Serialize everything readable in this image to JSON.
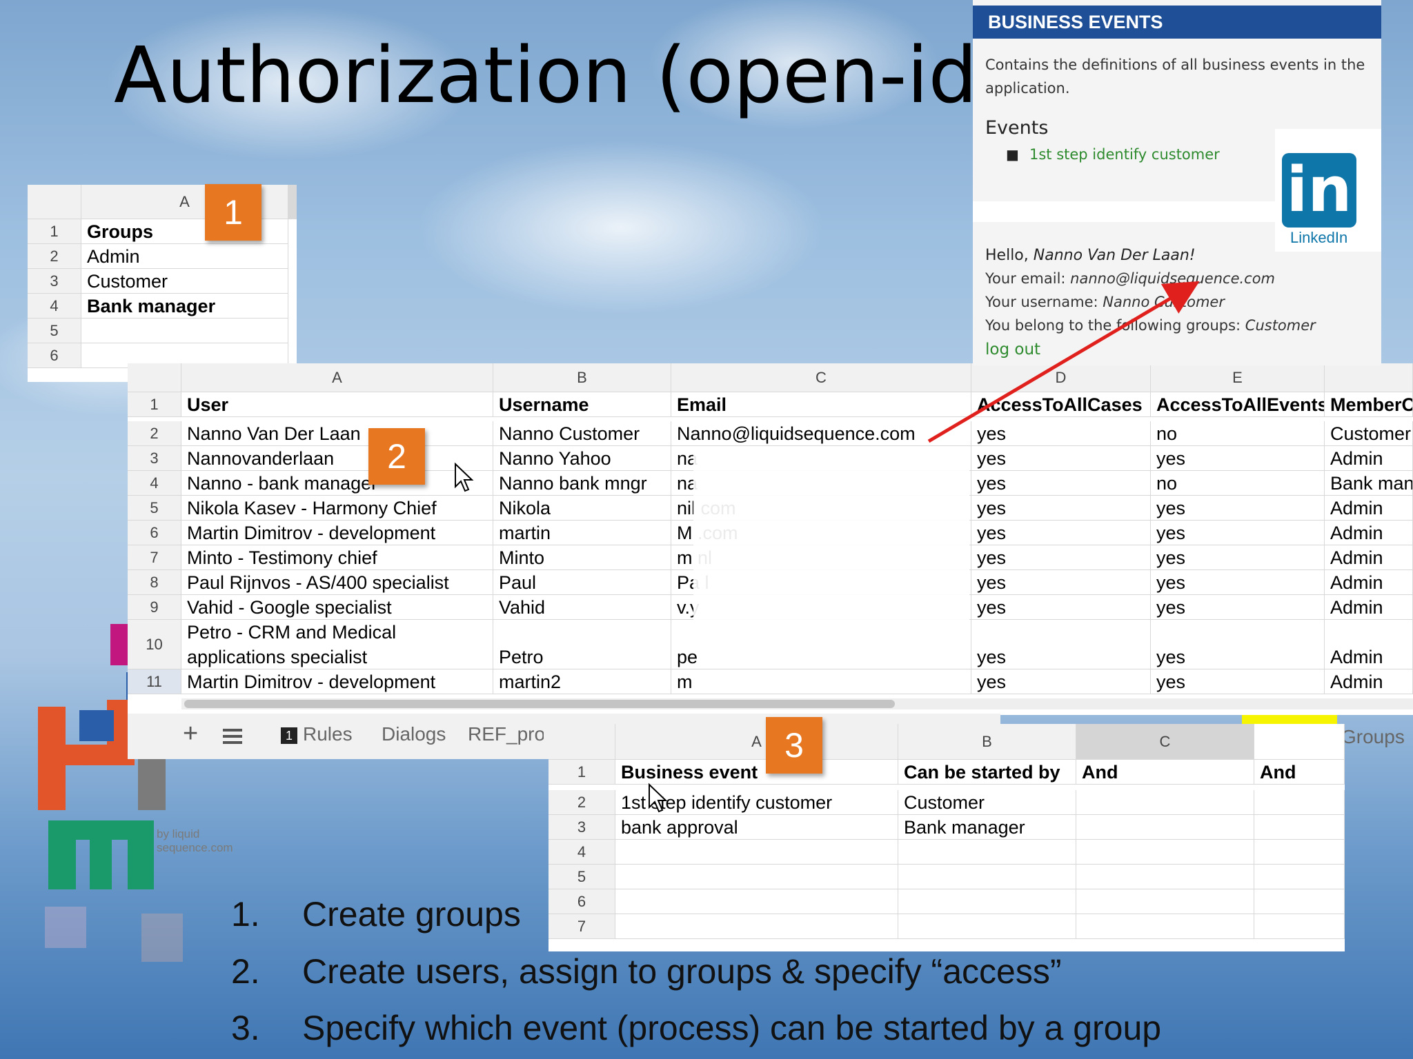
{
  "slide": {
    "title": "Authorization (open-id)",
    "list": [
      {
        "num": "1.",
        "text": "Create groups"
      },
      {
        "num": "2.",
        "text": "Create users, assign to groups  & specify “access”"
      },
      {
        "num": "3.",
        "text": "Specify which event (process) can be started by a group"
      }
    ],
    "badges": [
      "1",
      "2",
      "3"
    ],
    "logo_caption": "by liquid sequence.com"
  },
  "panel": {
    "header": "BUSINESS EVENTS",
    "description_line1": "Contains the definitions of all business events in the",
    "description_line2": "application.",
    "events_heading": "Events",
    "event_link": "1st step identify customer",
    "linkedin_label": "LinkedIn",
    "hello_prefix": "Hello, ",
    "hello_name": "Nanno Van Der Laan!",
    "email_label": "Your email: ",
    "email_value": "nanno@liquidsequence.com",
    "username_label": "Your username: ",
    "username_value": "Nanno Customer",
    "groups_label": "You belong to the following groups: ",
    "groups_value": "Customer",
    "logout": "log out"
  },
  "groups_sheet": {
    "col": "A",
    "rows": [
      {
        "n": "1",
        "v": "Groups",
        "bold": true
      },
      {
        "n": "2",
        "v": "Admin"
      },
      {
        "n": "3",
        "v": "Customer"
      },
      {
        "n": "4",
        "v": "Bank manager",
        "bold": true
      },
      {
        "n": "5",
        "v": ""
      },
      {
        "n": "6",
        "v": ""
      }
    ]
  },
  "users_sheet": {
    "cols": [
      "A",
      "B",
      "C",
      "D",
      "E"
    ],
    "header": [
      "User",
      "Username",
      "Email",
      "AccessToAllCases",
      "AccessToAllEvents",
      "MemberOf"
    ],
    "rows": [
      {
        "n": "2",
        "c": [
          "Nanno Van Der Laan",
          "Nanno Customer",
          "Nanno@liquidsequence.com",
          "yes",
          "no",
          "Customer"
        ]
      },
      {
        "n": "3",
        "c": [
          "Nannovanderlaan",
          "Nanno Yahoo",
          "na",
          "yes",
          "yes",
          "Admin"
        ]
      },
      {
        "n": "4",
        "c": [
          "Nanno - bank manager",
          "Nanno bank mngr",
          "na",
          "yes",
          "no",
          "Bank manager"
        ]
      },
      {
        "n": "5",
        "c": [
          "Nikola Kasev - Harmony Chief",
          "Nikola",
          "nil                               com",
          "yes",
          "yes",
          "Admin"
        ]
      },
      {
        "n": "6",
        "c": [
          "Martin Dimitrov - development",
          "martin",
          "M                               .com",
          "yes",
          "yes",
          "Admin"
        ]
      },
      {
        "n": "7",
        "c": [
          "Minto - Testimony chief",
          "Minto",
          "m                                  nl",
          "yes",
          "yes",
          "Admin"
        ]
      },
      {
        "n": "8",
        "c": [
          "Paul Rijnvos - AS/400 specialist",
          "Paul",
          "Pa                                  l",
          "yes",
          "yes",
          "Admin"
        ]
      },
      {
        "n": "9",
        "c": [
          "Vahid - Google specialist",
          "Vahid",
          "v.y",
          "yes",
          "yes",
          "Admin"
        ]
      },
      {
        "n": "10",
        "c": [
          "Petro - CRM and Medical",
          "Petro",
          "pe",
          "yes",
          "yes",
          "Admin"
        ],
        "line2": "applications specialist"
      },
      {
        "n": "11",
        "c": [
          "Martin Dimitrov - development",
          "martin2",
          "m",
          "yes",
          "yes",
          "Admin"
        ]
      }
    ],
    "tabs": [
      "Rules",
      "Dialogs",
      "REF_proc",
      "Groups"
    ],
    "tab_rules_count": "1"
  },
  "events_sheet": {
    "cols": [
      "A",
      "B",
      "C"
    ],
    "header": [
      "Business event",
      "Can be started by",
      "And",
      "And"
    ],
    "rows": [
      {
        "n": "2",
        "c": [
          "1st step identify customer",
          "Customer",
          "",
          ""
        ]
      },
      {
        "n": "3",
        "c": [
          "bank approval",
          "Bank manager",
          "",
          ""
        ]
      },
      {
        "n": "4",
        "c": [
          "",
          "",
          "",
          ""
        ]
      },
      {
        "n": "5",
        "c": [
          "",
          "",
          "",
          ""
        ]
      },
      {
        "n": "6",
        "c": [
          "",
          "",
          "",
          ""
        ]
      },
      {
        "n": "7",
        "c": [
          "",
          "",
          "",
          ""
        ]
      }
    ]
  },
  "colors": {
    "accent": "#e87722",
    "panel_header": "#1e4f97",
    "link_green": "#2d8a2d",
    "arrow": "#e0201c"
  }
}
